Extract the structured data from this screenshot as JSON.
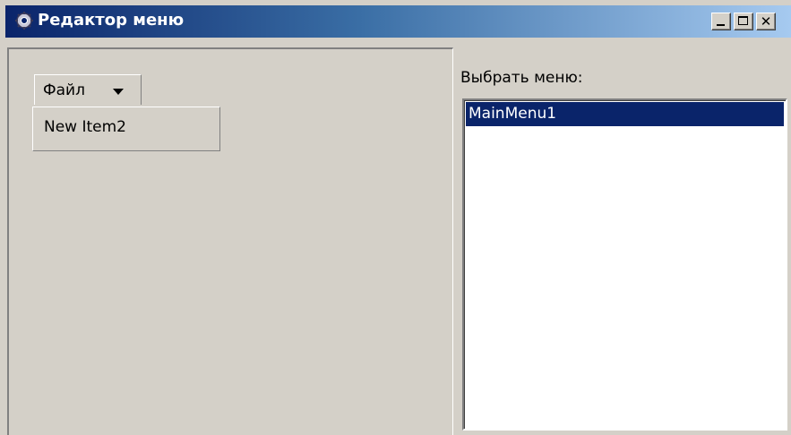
{
  "window": {
    "title": "Редактор меню",
    "icon": "app-gear-icon",
    "controls": {
      "minimize": "minimize-icon",
      "maximize": "maximize-icon",
      "close": "close-icon"
    }
  },
  "menu_preview": {
    "top_menu_label": "Файл",
    "dropdown_icon": "caret-down-icon",
    "items": [
      {
        "label": "New Item2"
      }
    ]
  },
  "menu_selector": {
    "label": "Выбрать меню:",
    "items": [
      {
        "label": "MainMenu1",
        "selected": true
      }
    ]
  },
  "colors": {
    "title_gradient_start": "#0a246a",
    "title_gradient_end": "#a6caf0",
    "selection": "#0a246a",
    "face": "#d4d0c8"
  }
}
